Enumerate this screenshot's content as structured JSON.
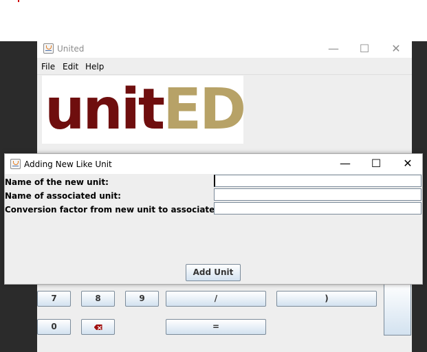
{
  "main_window": {
    "title": "United",
    "menu": [
      "File",
      "Edit",
      "Help"
    ],
    "logo": {
      "part1": "unit",
      "part2": "ED"
    },
    "keypad": {
      "row1": [
        "7",
        "8",
        "9",
        "/",
        ")"
      ],
      "row2": {
        "zero": "0",
        "equals": "="
      },
      "backspace_icon": "backspace-icon"
    }
  },
  "dialog": {
    "title": "Adding New Like Unit",
    "fields": [
      {
        "label": "Name of the new unit:",
        "value": ""
      },
      {
        "label": "Name of associated unit:",
        "value": ""
      },
      {
        "label": "Conversion factor from new unit to associated unit:",
        "value": ""
      }
    ],
    "add_button": "Add Unit"
  },
  "window_controls": {
    "minimize": "—",
    "maximize": "☐",
    "close": "✕"
  }
}
